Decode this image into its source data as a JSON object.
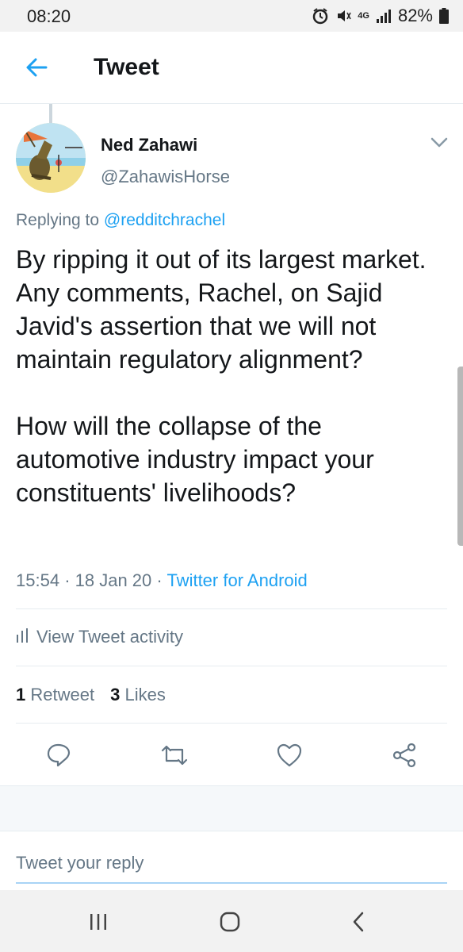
{
  "status_bar": {
    "time": "08:20",
    "network": "4G",
    "battery": "82%"
  },
  "header": {
    "title": "Tweet",
    "back_icon": "arrow-left-icon"
  },
  "tweet": {
    "author_name": "Ned Zahawi",
    "author_handle": "@ZahawisHorse",
    "replying_prefix": "Replying to ",
    "replying_to": "@redditchrachel",
    "text": "By ripping it out of its largest market. Any comments, Rachel, on Sajid Javid's assertion that we will not maintain regulatory alignment?\n\nHow will the collapse of the automotive industry impact your constituents' livelihoods?",
    "time": "15:54",
    "date": "18 Jan 20",
    "source": "Twitter for Android",
    "separator": "·"
  },
  "activity": {
    "label": "View Tweet activity"
  },
  "stats": {
    "retweets_count": "1",
    "retweets_label": "Retweet",
    "likes_count": "3",
    "likes_label": "Likes"
  },
  "actions": [
    "reply-icon",
    "retweet-icon",
    "like-icon",
    "share-icon"
  ],
  "reply_box": {
    "placeholder": "Tweet your reply"
  },
  "colors": {
    "accent": "#1da1f2",
    "secondary_text": "#657786",
    "primary_text": "#14171a",
    "divider": "#e6ecf0"
  }
}
